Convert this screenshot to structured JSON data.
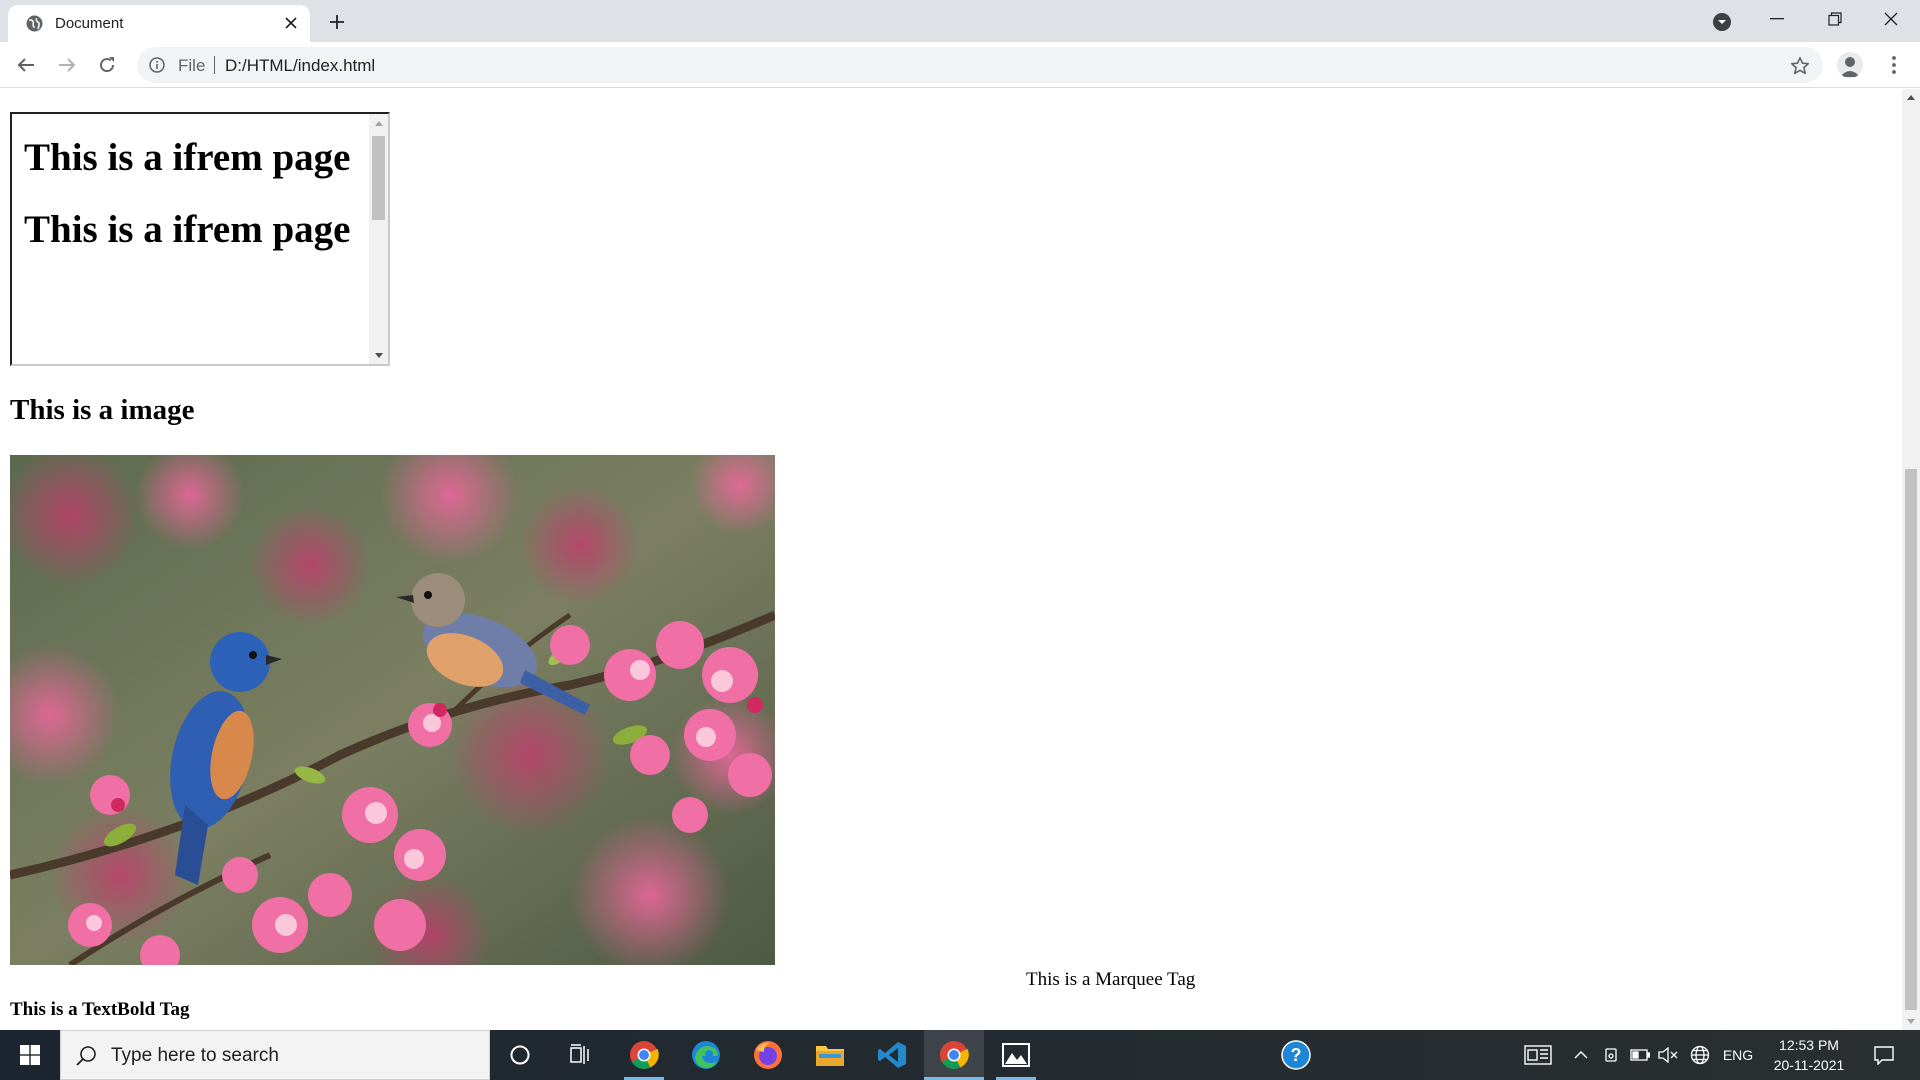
{
  "browser": {
    "tab_title": "Document",
    "address_chip": "File",
    "url": "D:/HTML/index.html"
  },
  "page": {
    "iframe_headings": [
      "This is a ifrem page",
      "This is a ifrem page"
    ],
    "image_heading": "This is a image",
    "image_alt": "Two bluebirds perched on a branch of pink blossoms",
    "marquee_text": "This is a Marquee Tag",
    "bold_text": "This is a TextBold Tag"
  },
  "taskbar": {
    "search_placeholder": "Type here to search",
    "apps": [
      "cortana-icon",
      "task-view-icon",
      "chrome-icon",
      "edge-icon",
      "firefox-icon",
      "file-explorer-icon",
      "vscode-icon",
      "chrome-icon",
      "photos-icon",
      "help-icon"
    ],
    "language": "ENG",
    "time": "12:53 PM",
    "date": "20-11-2021"
  },
  "colors": {
    "tabstrip": "#dee1e6",
    "omnibox": "#f1f3f4",
    "taskbar": "#1f2933",
    "taskbar_accent": "#76b9ed"
  }
}
